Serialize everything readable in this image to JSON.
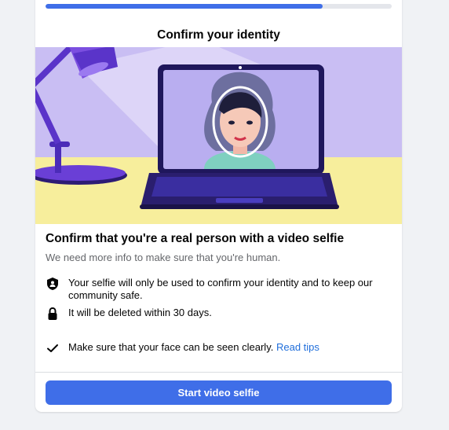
{
  "dialog": {
    "progress_percent": 80,
    "title": "Confirm your identity",
    "heading": "Confirm that you're a real person with a video selfie",
    "subtext": "We need more info to make sure that you're human.",
    "info_items": [
      {
        "icon": "shield-person-icon",
        "text": "Your selfie will only be used to confirm your identity and to keep our community safe."
      },
      {
        "icon": "lock-icon",
        "text": "It will be deleted within 30 days."
      },
      {
        "icon": "checkmark-icon",
        "text": "Make sure that your face can be seen clearly.",
        "link": "Read tips"
      }
    ],
    "primary_button": "Start video selfie"
  },
  "colors": {
    "accent": "#3f6ee8",
    "link": "#216fdb",
    "illustration_background": "#c9bef3",
    "desk": "#f7ee9c",
    "laptop": "#2a1e6e",
    "lamp": "#6a3fd6"
  }
}
